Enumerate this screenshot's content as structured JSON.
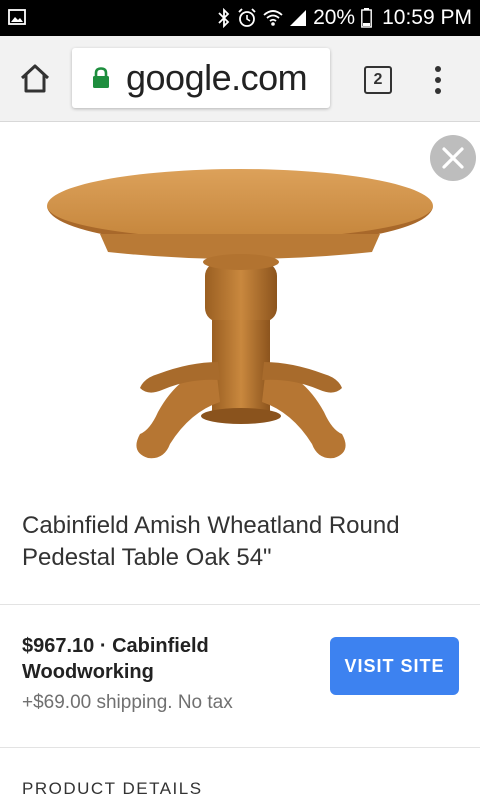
{
  "status_bar": {
    "battery": "20%",
    "time": "10:59 PM"
  },
  "browser": {
    "url": "google.com",
    "tab_count": "2"
  },
  "product": {
    "title_line1": "Cabinfield Amish Wheatland Round",
    "title_line2": "Pedestal Table Oak 54\"",
    "price_line1": "$967.10 · Cabinfield",
    "price_line2": "Woodworking",
    "shipping": "+$69.00 shipping. No tax",
    "visit_label": "VISIT SITE"
  },
  "sections": {
    "details_label": "PRODUCT DETAILS"
  },
  "colors": {
    "accent": "#3d82f0",
    "lock": "#1e8e3e",
    "wood": "#c98a3e"
  }
}
